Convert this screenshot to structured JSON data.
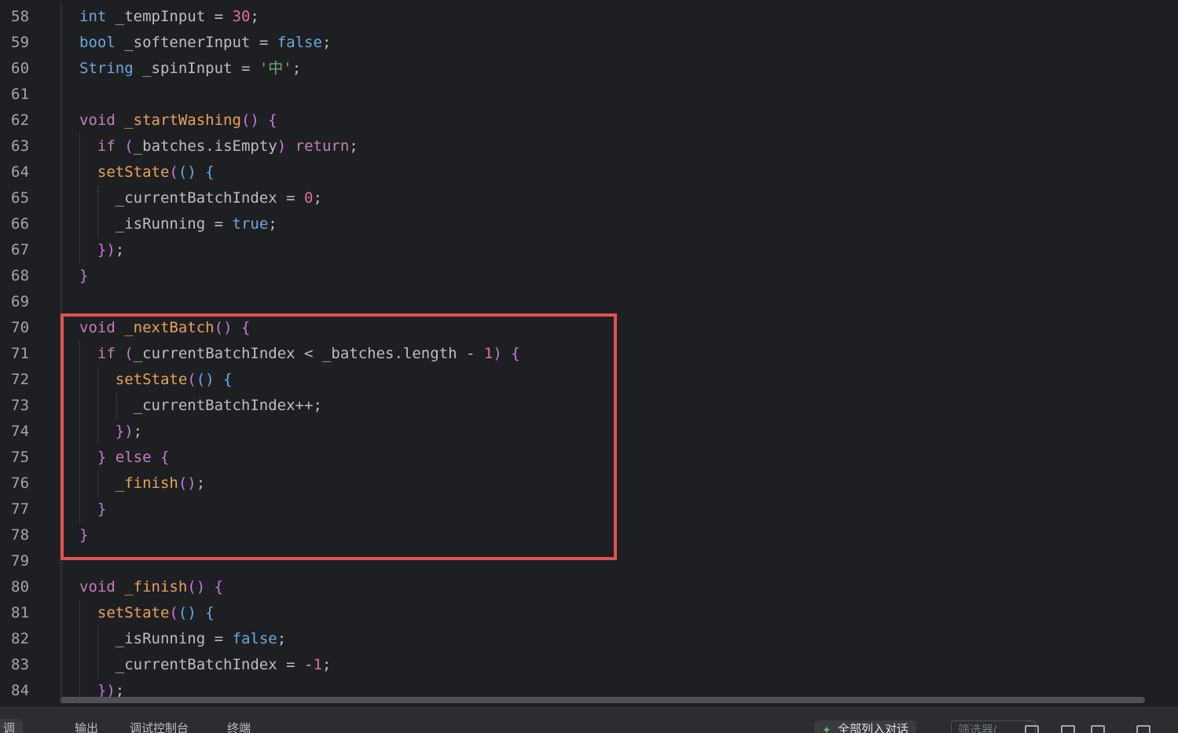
{
  "editor": {
    "line_numbers": [
      "58",
      "59",
      "60",
      "61",
      "62",
      "63",
      "64",
      "65",
      "66",
      "67",
      "68",
      "69",
      "70",
      "71",
      "72",
      "73",
      "74",
      "75",
      "76",
      "77",
      "78",
      "79",
      "80",
      "81",
      "82",
      "83",
      "84"
    ],
    "code_lines": [
      "int _tempInput = 30;",
      "bool _softenerInput = false;",
      "String _spinInput = '中';",
      "",
      "void _startWashing() {",
      "  if (_batches.isEmpty) return;",
      "  setState(() {",
      "    _currentBatchIndex = 0;",
      "    _isRunning = true;",
      "  });",
      "}",
      "",
      "void _nextBatch() {",
      "  if (_currentBatchIndex < _batches.length - 1) {",
      "    setState(() {",
      "      _currentBatchIndex++;",
      "    });",
      "  } else {",
      "    _finish();",
      "  }",
      "}",
      "",
      "void _finish() {",
      "  setState(() {",
      "    _isRunning = false;",
      "    _currentBatchIndex = -1;",
      "  });"
    ]
  },
  "colors": {
    "background": "#1e1f22",
    "keyword": "#c77dbb",
    "type": "#6fa8dc",
    "function": "#e8a25a",
    "number": "#e06c9f",
    "string": "#6aab73",
    "highlight_border": "#e05252"
  },
  "bottom_panel": {
    "tabs": [
      "调",
      "输出",
      "调试控制台",
      "终端"
    ],
    "ai_button_label": "全部列入对话",
    "filter_placeholder": "筛选器(",
    "icons": [
      "sparkle-icon",
      "layout-icon",
      "panel-icon",
      "split-icon"
    ]
  }
}
